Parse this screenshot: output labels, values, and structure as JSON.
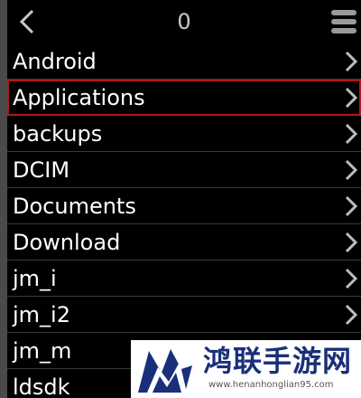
{
  "header": {
    "title": "0",
    "back_icon": "chevron-left-icon",
    "menu_icon": "hamburger-menu-icon"
  },
  "list": {
    "items": [
      {
        "label": "Android",
        "selected": false
      },
      {
        "label": "Applications",
        "selected": true
      },
      {
        "label": "backups",
        "selected": false
      },
      {
        "label": "DCIM",
        "selected": false
      },
      {
        "label": "Documents",
        "selected": false
      },
      {
        "label": "Download",
        "selected": false
      },
      {
        "label": "jm_i",
        "selected": false
      },
      {
        "label": "jm_i2",
        "selected": false
      },
      {
        "label": "jm_m",
        "selected": false
      },
      {
        "label": "ldsdk",
        "selected": false
      }
    ],
    "row_icon": "chevron-right-icon"
  },
  "watermark": {
    "title": "鸿联手游网",
    "url": "www.henanhonglian95.com"
  },
  "colors": {
    "background": "#000000",
    "text": "#ffffff",
    "selection_border": "#b01818",
    "watermark_text": "#1a2f7a"
  }
}
